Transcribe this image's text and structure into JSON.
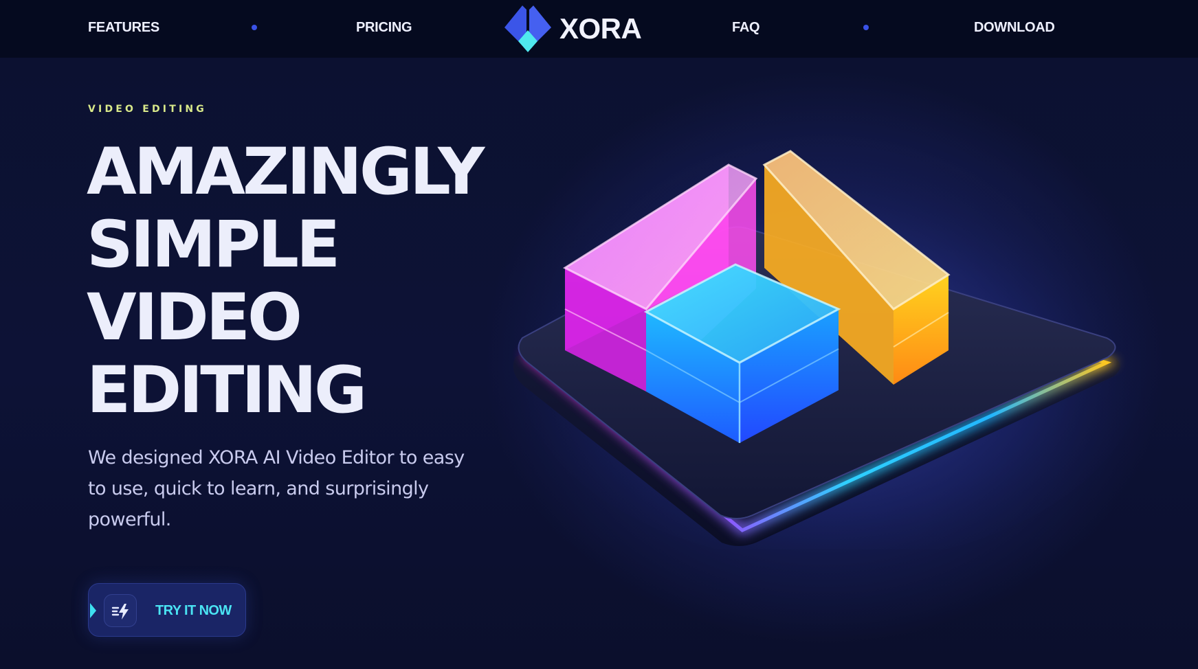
{
  "nav": {
    "links": [
      "FEATURES",
      "PRICING",
      "FAQ",
      "DOWNLOAD"
    ],
    "logo_text": "XORA",
    "logo_icon": "xora-logo-icon"
  },
  "hero": {
    "eyebrow": "VIDEO EDITING",
    "headline_lines": [
      "AMAZINGLY",
      "SIMPLE",
      "VIDEO",
      "EDITING"
    ],
    "subtitle": "We designed XORA AI Video Editor to easy to use, quick to learn, and surprisingly powerful.",
    "cta_label": "TRY IT NOW",
    "cta_icon": "zap-icon",
    "art_name": "glass-blocks-illustration"
  },
  "colors": {
    "background": "#0c1130",
    "nav_background": "#050a1f",
    "accent_cyan": "#4ae4f3",
    "eyebrow_lime": "#d9e98a",
    "dot_blue": "#3a52e6",
    "magenta": "#ff3de8",
    "orange": "#ffb21f",
    "blue": "#1f8cff"
  }
}
